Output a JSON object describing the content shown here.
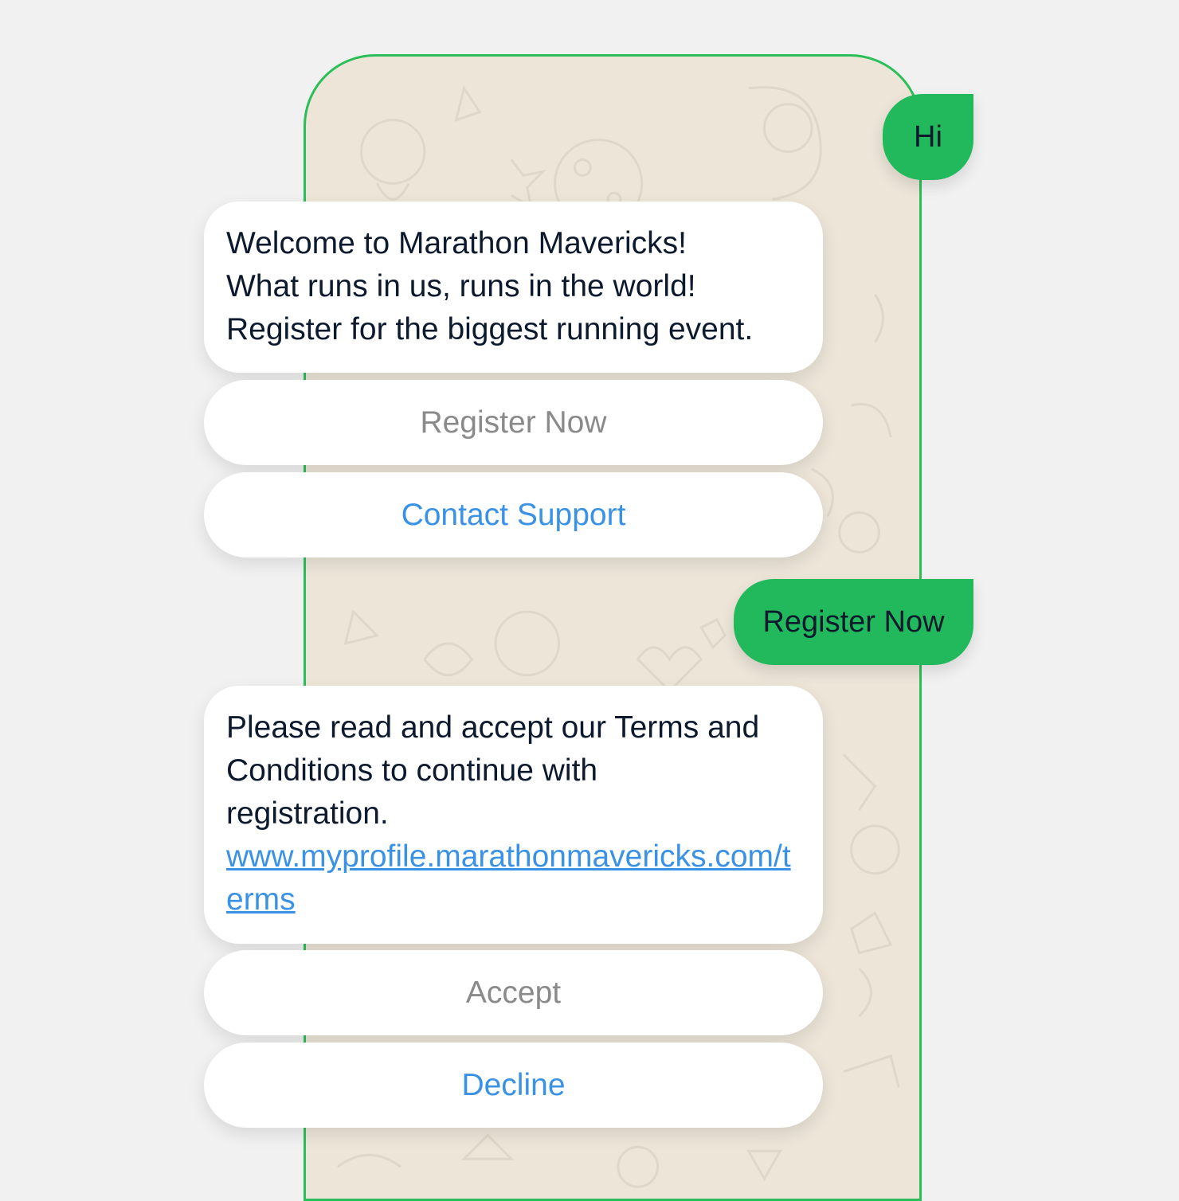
{
  "chat": {
    "messages": [
      {
        "type": "outgoing",
        "text": "Hi"
      },
      {
        "type": "incoming",
        "lines": [
          "Welcome to Marathon Mavericks!",
          "What runs in us, runs in the world!",
          "Register for the biggest running event."
        ]
      },
      {
        "type": "outgoing",
        "text": "Register Now"
      },
      {
        "type": "incoming",
        "lines": [
          "Please read and accept our Terms and",
          "Conditions to continue with",
          "registration."
        ],
        "link": "www.myprofile.marathonmavericks.com/terms"
      }
    ],
    "quick_replies_1": [
      "Register Now",
      "Contact Support"
    ],
    "quick_replies_2": [
      "Accept",
      "Decline"
    ]
  },
  "colors": {
    "accent_green": "#21b95c",
    "frame_green": "#2bbf5a",
    "link_blue": "#3a92e6",
    "chat_background": "#ece5d8"
  }
}
